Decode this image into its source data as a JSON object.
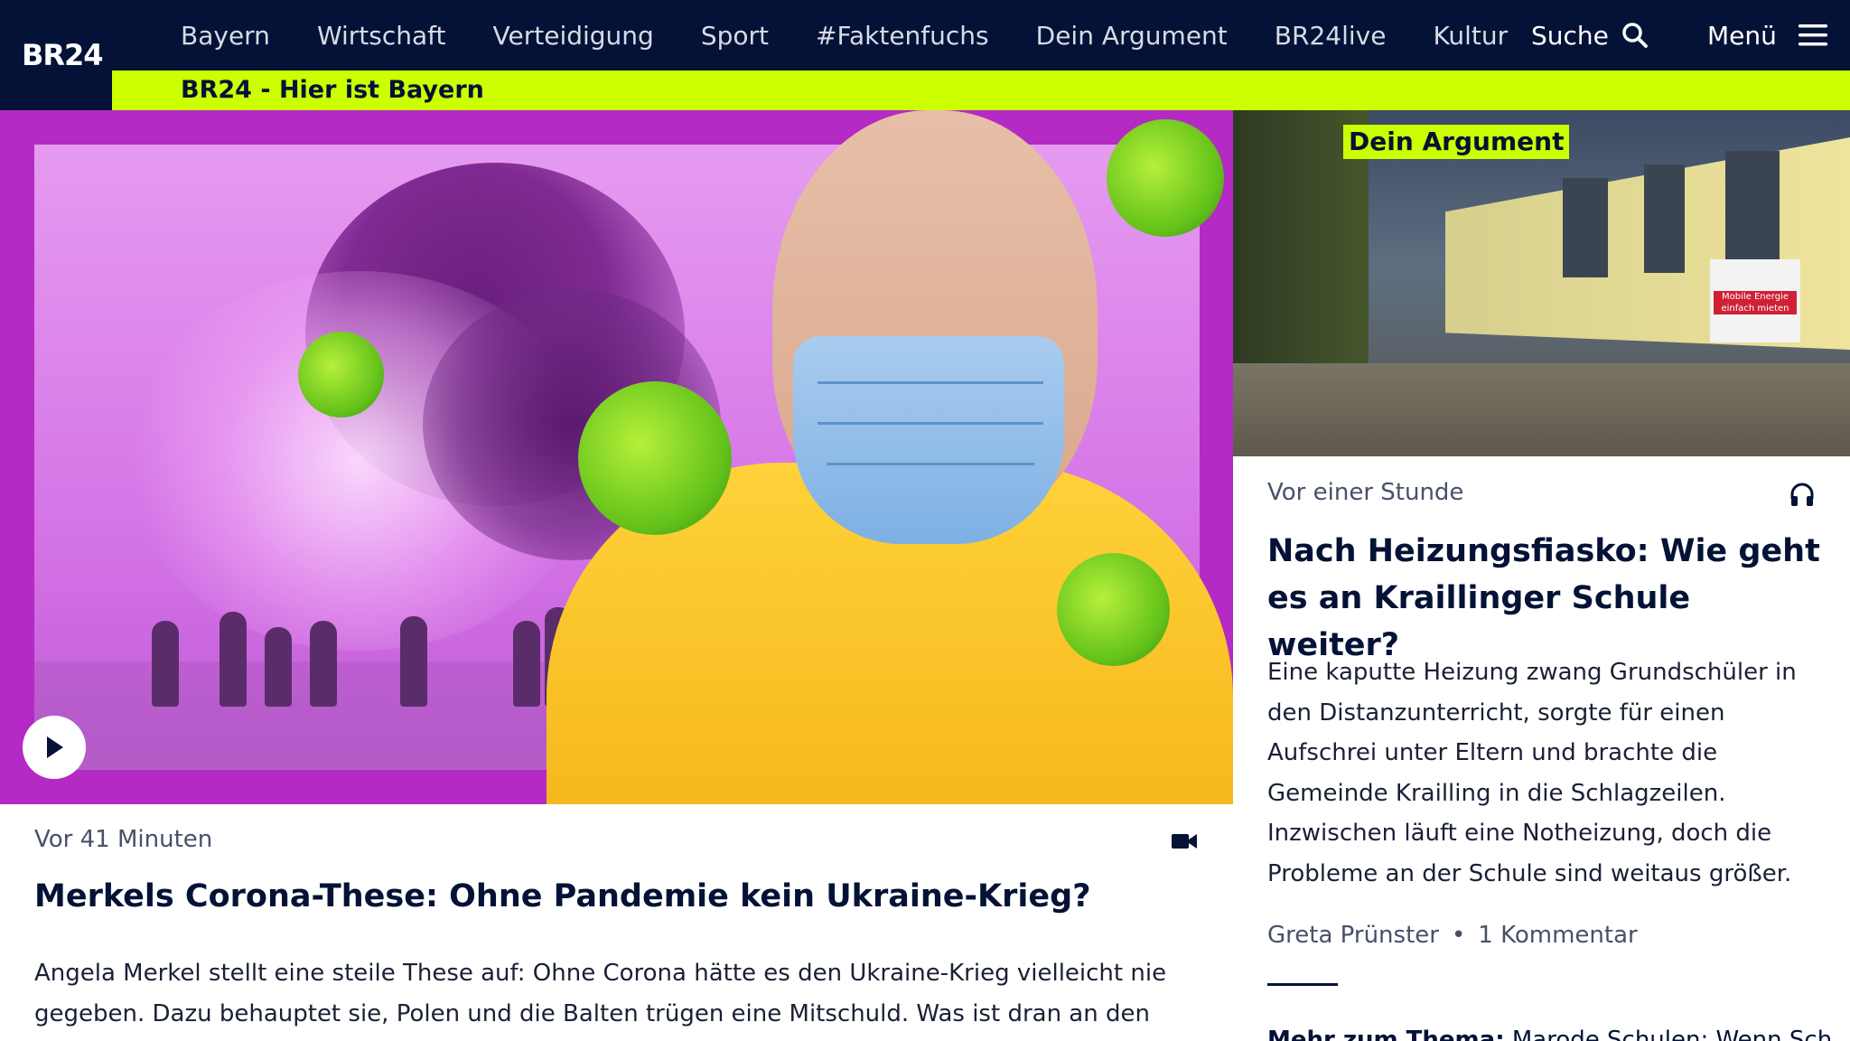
{
  "header": {
    "logo": "BR24",
    "nav": [
      "Bayern",
      "Wirtschaft",
      "Verteidigung",
      "Sport",
      "#Faktenfuchs",
      "Dein Argument",
      "BR24live",
      "Kultur"
    ],
    "search_label": "Suche",
    "menu_label": "Menü",
    "tagline": "BR24 - Hier ist Bayern"
  },
  "lead_article": {
    "time": "Vor 41 Minuten",
    "title": "Merkels Corona-These: Ohne Pandemie kein Ukraine-Krieg?",
    "teaser": "Angela Merkel stellt eine steile These auf: Ohne Corona hätte es den Ukraine-Krieg vielleicht nie gegeben. Dazu behauptet sie, Polen und die Balten trügen eine Mitschuld. Was ist dran an den",
    "media_icon": "video-camera-icon"
  },
  "side_article": {
    "tag": "Dein Argument",
    "image_sign": "Mobile Energie einfach mieten",
    "time": "Vor einer Stunde",
    "title": "Nach Heizungsfiasko: Wie geht es an Kraillinger Schule weiter?",
    "teaser": "Eine kaputte Heizung zwang Grundschüler in den Distanzunterricht, sorgte für einen Aufschrei unter Eltern und brachte die Gemeinde Krailling in die Schlagzeilen. Inzwischen läuft eine Notheizung, doch die Probleme an der Schule sind weitaus größer.",
    "author": "Greta Prünster",
    "comments": "1 Kommentar",
    "more_label": "Mehr zum Thema:",
    "more_text": "Marode Schulen: Wenn Sch",
    "media_icon": "headphones-icon"
  },
  "colors": {
    "navy": "#031236",
    "accent": "#ccff00",
    "hero_bg": "#b529c4"
  }
}
